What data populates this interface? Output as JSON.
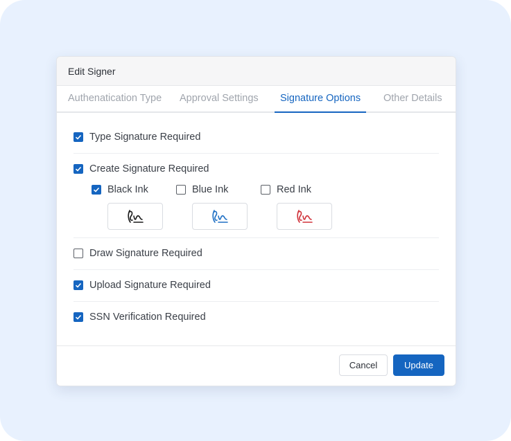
{
  "dialog": {
    "title": "Edit Signer"
  },
  "tabs": [
    {
      "label": "Authenatication Type",
      "active": false
    },
    {
      "label": "Approval Settings",
      "active": false
    },
    {
      "label": "Signature Options",
      "active": true
    },
    {
      "label": "Other Details",
      "active": false
    }
  ],
  "options": {
    "type_signature": {
      "label": "Type Signature Required",
      "checked": true
    },
    "create_signature": {
      "label": "Create Signature Required",
      "checked": true
    },
    "draw_signature": {
      "label": "Draw Signature Required",
      "checked": false
    },
    "upload_signature": {
      "label": "Upload Signature Required",
      "checked": true
    },
    "ssn_verification": {
      "label": "SSN Verification Required",
      "checked": true
    }
  },
  "inks": [
    {
      "label": "Black Ink",
      "checked": true,
      "color": "#1a1a1a",
      "icon": "signature-icon"
    },
    {
      "label": "Blue Ink",
      "checked": false,
      "color": "#1e6fc4",
      "icon": "signature-icon"
    },
    {
      "label": "Red Ink",
      "checked": false,
      "color": "#d0323a",
      "icon": "signature-icon"
    }
  ],
  "footer": {
    "cancel_label": "Cancel",
    "update_label": "Update"
  },
  "colors": {
    "accent": "#1565c0",
    "background": "#e8f1fe"
  }
}
